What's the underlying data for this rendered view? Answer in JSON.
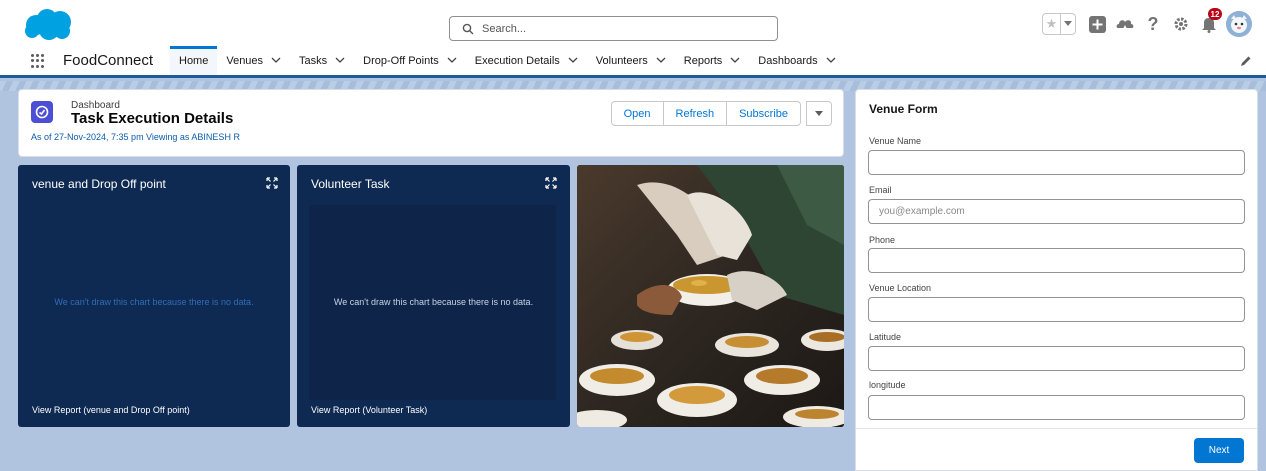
{
  "header": {
    "logo_icon": "salesforce-cloud-icon",
    "search_placeholder": "Search...",
    "notification_count": "12"
  },
  "nav": {
    "app_name": "FoodConnect",
    "items": [
      {
        "label": "Home",
        "active": true,
        "dropdown": false
      },
      {
        "label": "Venues",
        "dropdown": true
      },
      {
        "label": "Tasks",
        "dropdown": true
      },
      {
        "label": "Drop-Off Points",
        "dropdown": true
      },
      {
        "label": "Execution Details",
        "dropdown": true
      },
      {
        "label": "Volunteers",
        "dropdown": true
      },
      {
        "label": "Reports",
        "dropdown": true
      },
      {
        "label": "Dashboards",
        "dropdown": true
      }
    ]
  },
  "dashboard": {
    "kicker": "Dashboard",
    "title": "Task Execution Details",
    "subtitle": "As of 27-Nov-2024, 7:35 pm Viewing as ABINESH R",
    "buttons": {
      "open": "Open",
      "refresh": "Refresh",
      "subscribe": "Subscribe"
    },
    "widgets": [
      {
        "title": "venue and Drop Off point",
        "empty_message": "We can't draw this chart because there is no data.",
        "link": "View Report (venue and Drop Off point)"
      },
      {
        "title": "Volunteer Task",
        "empty_message": "We can't draw this chart because there is no data.",
        "link": "View Report (Volunteer Task)"
      }
    ]
  },
  "venue_form": {
    "title": "Venue Form",
    "fields": [
      {
        "label": "Venue Name",
        "value": "",
        "placeholder": ""
      },
      {
        "label": "Email",
        "value": "",
        "placeholder": "you@example.com"
      },
      {
        "label": "Phone",
        "value": "",
        "placeholder": ""
      },
      {
        "label": "Venue Location",
        "value": "",
        "placeholder": ""
      },
      {
        "label": "Latitude",
        "value": "",
        "placeholder": ""
      },
      {
        "label": "longitude",
        "value": "",
        "placeholder": ""
      }
    ],
    "next_label": "Next"
  },
  "colors": {
    "brand": "#0176d3",
    "nav_underline": "#1b5a9c",
    "widget_bg": "#0f2a52",
    "page_bg": "#b0c4df",
    "dashboard_icon": "#4c4fd4"
  }
}
